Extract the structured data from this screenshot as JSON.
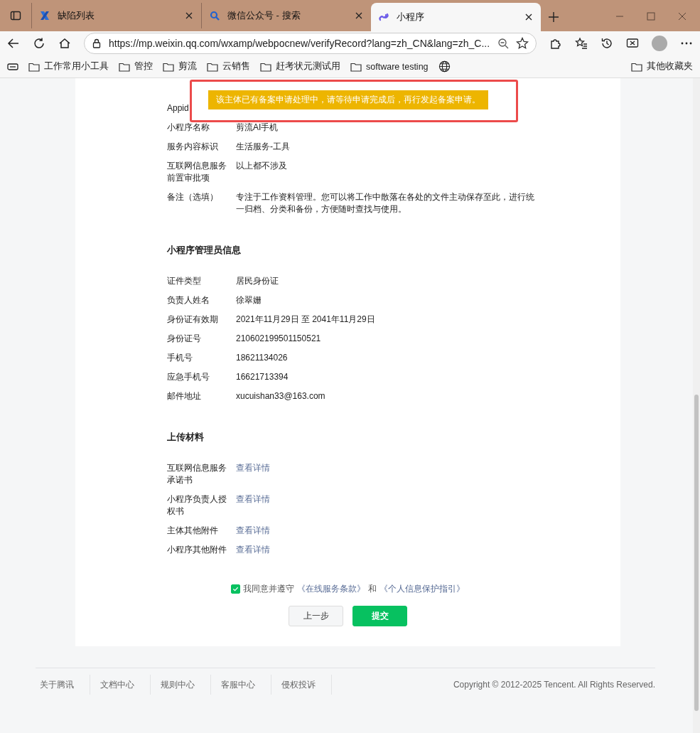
{
  "browser": {
    "tabs": [
      {
        "title": "缺陷列表",
        "selected": false
      },
      {
        "title": "微信公众号 - 搜索",
        "selected": false
      },
      {
        "title": "小程序",
        "selected": true
      }
    ],
    "url": "https://mp.weixin.qq.com/wxamp/webpocnew/verifyRecord?lang=zh_CN&lang=zh_C...",
    "bookmarks": [
      "工作常用小工具",
      "管控",
      "剪流",
      "云销售",
      "赶考状元测试用",
      "software testing"
    ],
    "other_bookmarks": "其他收藏夹"
  },
  "toast": "该主体已有备案申请处理中，请等待申请完成后，再行发起备案申请。",
  "app_info": {
    "rows": [
      {
        "label": "Appid"
      },
      {
        "label": "小程序名称",
        "value": "剪流AI手机"
      },
      {
        "label": "服务内容标识",
        "value": "生活服务-工具"
      },
      {
        "label": "互联网信息服务前置审批项",
        "value": "以上都不涉及"
      },
      {
        "label": "备注（选填）",
        "value": "专注于工作资料管理。您可以将工作中散落在各处的文件主动保存至此，进行统一归档、分类和备份，方便随时查找与使用。"
      }
    ]
  },
  "admin_info": {
    "title": "小程序管理员信息",
    "rows": [
      {
        "label": "证件类型",
        "value": "居民身份证"
      },
      {
        "label": "负责人姓名",
        "value": "徐翠姗"
      },
      {
        "label": "身份证有效期",
        "value": "2021年11月29日 至 2041年11月29日"
      },
      {
        "label": "身份证号",
        "value": "210602199501150521"
      },
      {
        "label": "手机号",
        "value": "18621134026"
      },
      {
        "label": "应急手机号",
        "value": "16621713394"
      },
      {
        "label": "邮件地址",
        "value": "xucuishan33@163.com"
      }
    ]
  },
  "materials": {
    "title": "上传材料",
    "rows": [
      {
        "label": "互联网信息服务承诺书",
        "link": "查看详情"
      },
      {
        "label": "小程序负责人授权书",
        "link": "查看详情"
      },
      {
        "label": "主体其他附件",
        "link": "查看详情"
      },
      {
        "label": "小程序其他附件",
        "link": "查看详情"
      }
    ]
  },
  "agreement": {
    "checked": true,
    "text": "我同意并遵守",
    "terms_link": "《在线服务条款》",
    "conjunction": "和",
    "privacy_link": "《个人信息保护指引》"
  },
  "buttons": {
    "back": "上一步",
    "submit": "提交"
  },
  "footer": {
    "links": [
      "关于腾讯",
      "文档中心",
      "规则中心",
      "客服中心",
      "侵权投诉"
    ],
    "copyright": "Copyright © 2012-2025 Tencent. All Rights Reserved."
  }
}
